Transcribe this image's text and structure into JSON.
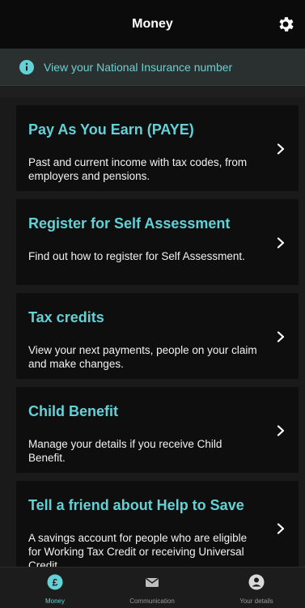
{
  "header": {
    "title": "Money"
  },
  "banner": {
    "text": "View your National Insurance number"
  },
  "cards": [
    {
      "title": "Pay As You Earn (PAYE)",
      "description": "Past and current income with tax codes, from employers and pensions."
    },
    {
      "title": "Register for Self Assessment",
      "description": "Find out how to register for Self Assessment."
    },
    {
      "title": "Tax credits",
      "description": "View your next payments, people on your claim and make changes."
    },
    {
      "title": "Child Benefit",
      "description": "Manage your details if you receive Child Benefit."
    },
    {
      "title": "Tell a friend about Help to Save",
      "description": "A savings account for people who are eligible for Working Tax Credit or receiving Universal Credit."
    }
  ],
  "tabs": [
    {
      "label": "Money",
      "icon": "pound-icon",
      "active": true
    },
    {
      "label": "Communication",
      "icon": "envelope-icon",
      "active": false
    },
    {
      "label": "Your details",
      "icon": "person-icon",
      "active": false
    }
  ],
  "colors": {
    "accent": "#63d1d6",
    "background": "#1f1f1f",
    "card": "#0e0e0e"
  }
}
